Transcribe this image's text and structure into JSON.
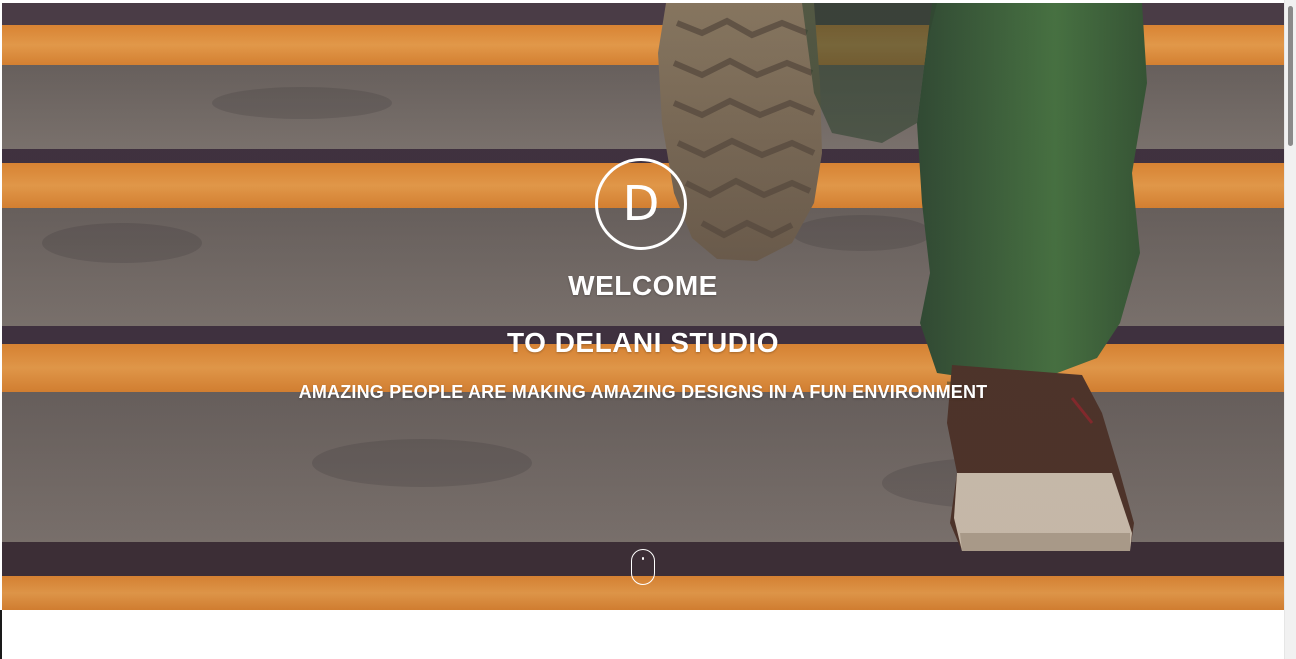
{
  "hero": {
    "logo_letter": "D",
    "welcome": "WELCOME",
    "title": "TO DELANI STUDIO",
    "tagline": "AMAZING PEOPLE ARE MAKING AMAZING DESIGNS IN A FUN ENVIRONMENT",
    "scroll_icon": "mouse-scroll-icon",
    "background_image": "person-walking-up-stairs"
  },
  "colors": {
    "stair_orange": "#f0a23a",
    "stair_gray": "#7a766e",
    "stair_shadow": "#3f3440",
    "text": "#ffffff",
    "pants_green": "#3f6b3a",
    "shoe_brown": "#5a3d2e"
  }
}
